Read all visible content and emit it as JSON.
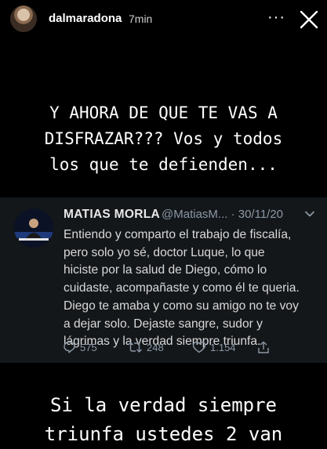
{
  "story": {
    "username": "dalmaradona",
    "time": "7min",
    "more_label": "···",
    "caption_top": [
      "Y AHORA DE QUE TE VAS A",
      "DISFRAZAR??? Vos y todos",
      "los que te defienden..."
    ],
    "caption_bottom": [
      "Si la verdad siempre",
      "triunfa ustedes 2 van"
    ]
  },
  "tweet": {
    "name": "MATIAS MORLA",
    "handle_date": "@MatiasM... · 30/11/20",
    "text_lines": [
      "Entiendo y comparto el trabajo de fiscalía,",
      "pero solo yo sé, doctor Luque, lo que",
      "hiciste por la salud de Diego, cómo lo",
      "cuidaste, acompañaste y como él te queria.",
      "Diego te amaba y como su amigo no te voy",
      "a dejar solo. Dejaste sangre, sudor y",
      "lágrimas y la verdad siempre triunfa."
    ],
    "replies": "575",
    "retweets": "248",
    "likes": "1.154"
  },
  "colors": {
    "background": "#000000",
    "tweet_card": "#14171a",
    "tweet_secondary": "#8b98a5"
  },
  "icons": [
    "more-icon",
    "close-icon",
    "chevron-down-icon",
    "reply-icon",
    "retweet-icon",
    "like-icon",
    "share-icon"
  ]
}
